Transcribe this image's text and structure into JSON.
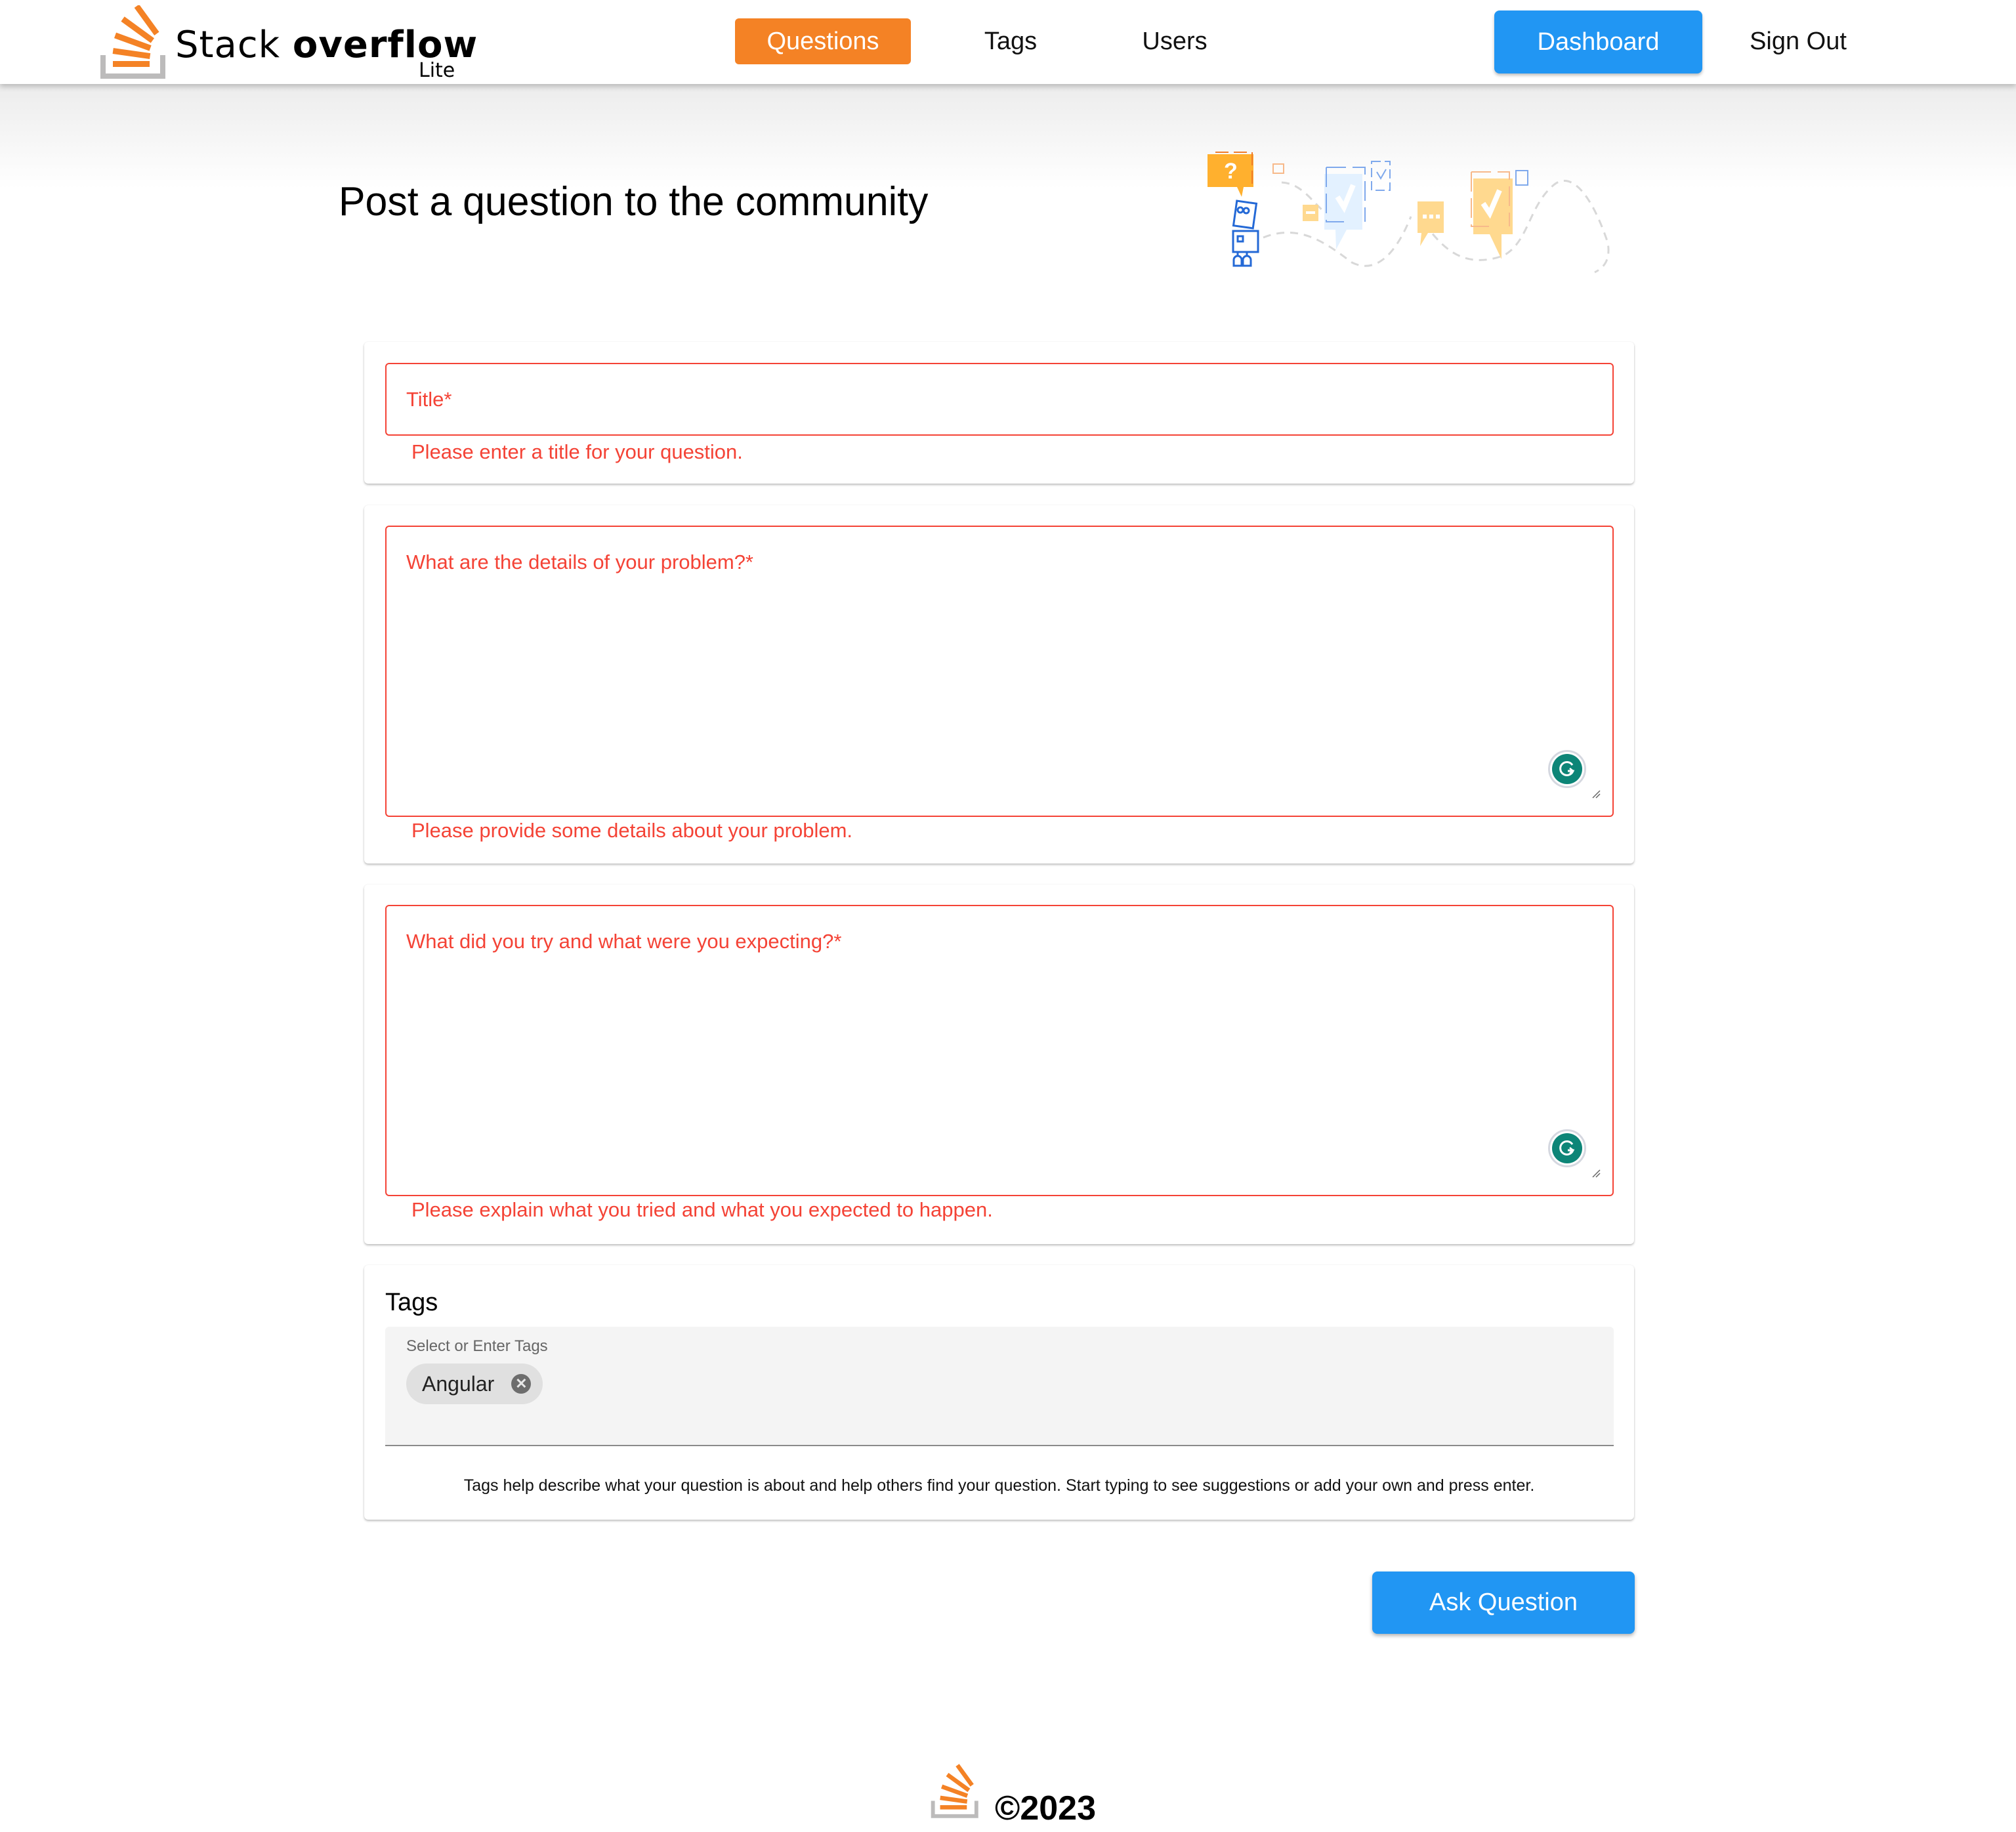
{
  "header": {
    "brand": {
      "name_regular": "Stack",
      "name_bold": "overflow",
      "suffix": "Lite"
    },
    "nav": {
      "questions": "Questions",
      "tags": "Tags",
      "users": "Users"
    },
    "dashboard_label": "Dashboard",
    "signout_label": "Sign Out",
    "active_item": "Questions"
  },
  "page": {
    "title": "Post a question to the community",
    "illustration": "robot-with-speech-bubbles"
  },
  "form": {
    "title_field": {
      "label": "Title*",
      "value": "",
      "error": "Please enter a title for your question."
    },
    "details_field": {
      "label": "What are the details of your problem?*",
      "value": "",
      "error": "Please provide some details about your problem."
    },
    "expectation_field": {
      "label": "What did you try and what were you expecting?*",
      "value": "",
      "error": "Please explain what you tried and what you expected to happen."
    },
    "tags": {
      "heading": "Tags",
      "field_label": "Select or Enter Tags",
      "selected": [
        {
          "label": "Angular"
        }
      ],
      "hint": "Tags help describe what your question is about and help others find your question. Start typing to see suggestions or add your own and press enter."
    },
    "submit_label": "Ask Question"
  },
  "footer": {
    "copyright": "©2023"
  },
  "colors": {
    "brand_orange": "#f48225",
    "primary_blue": "#2196f3",
    "error_red": "#f44336",
    "grammarly_green": "#0d8577"
  }
}
